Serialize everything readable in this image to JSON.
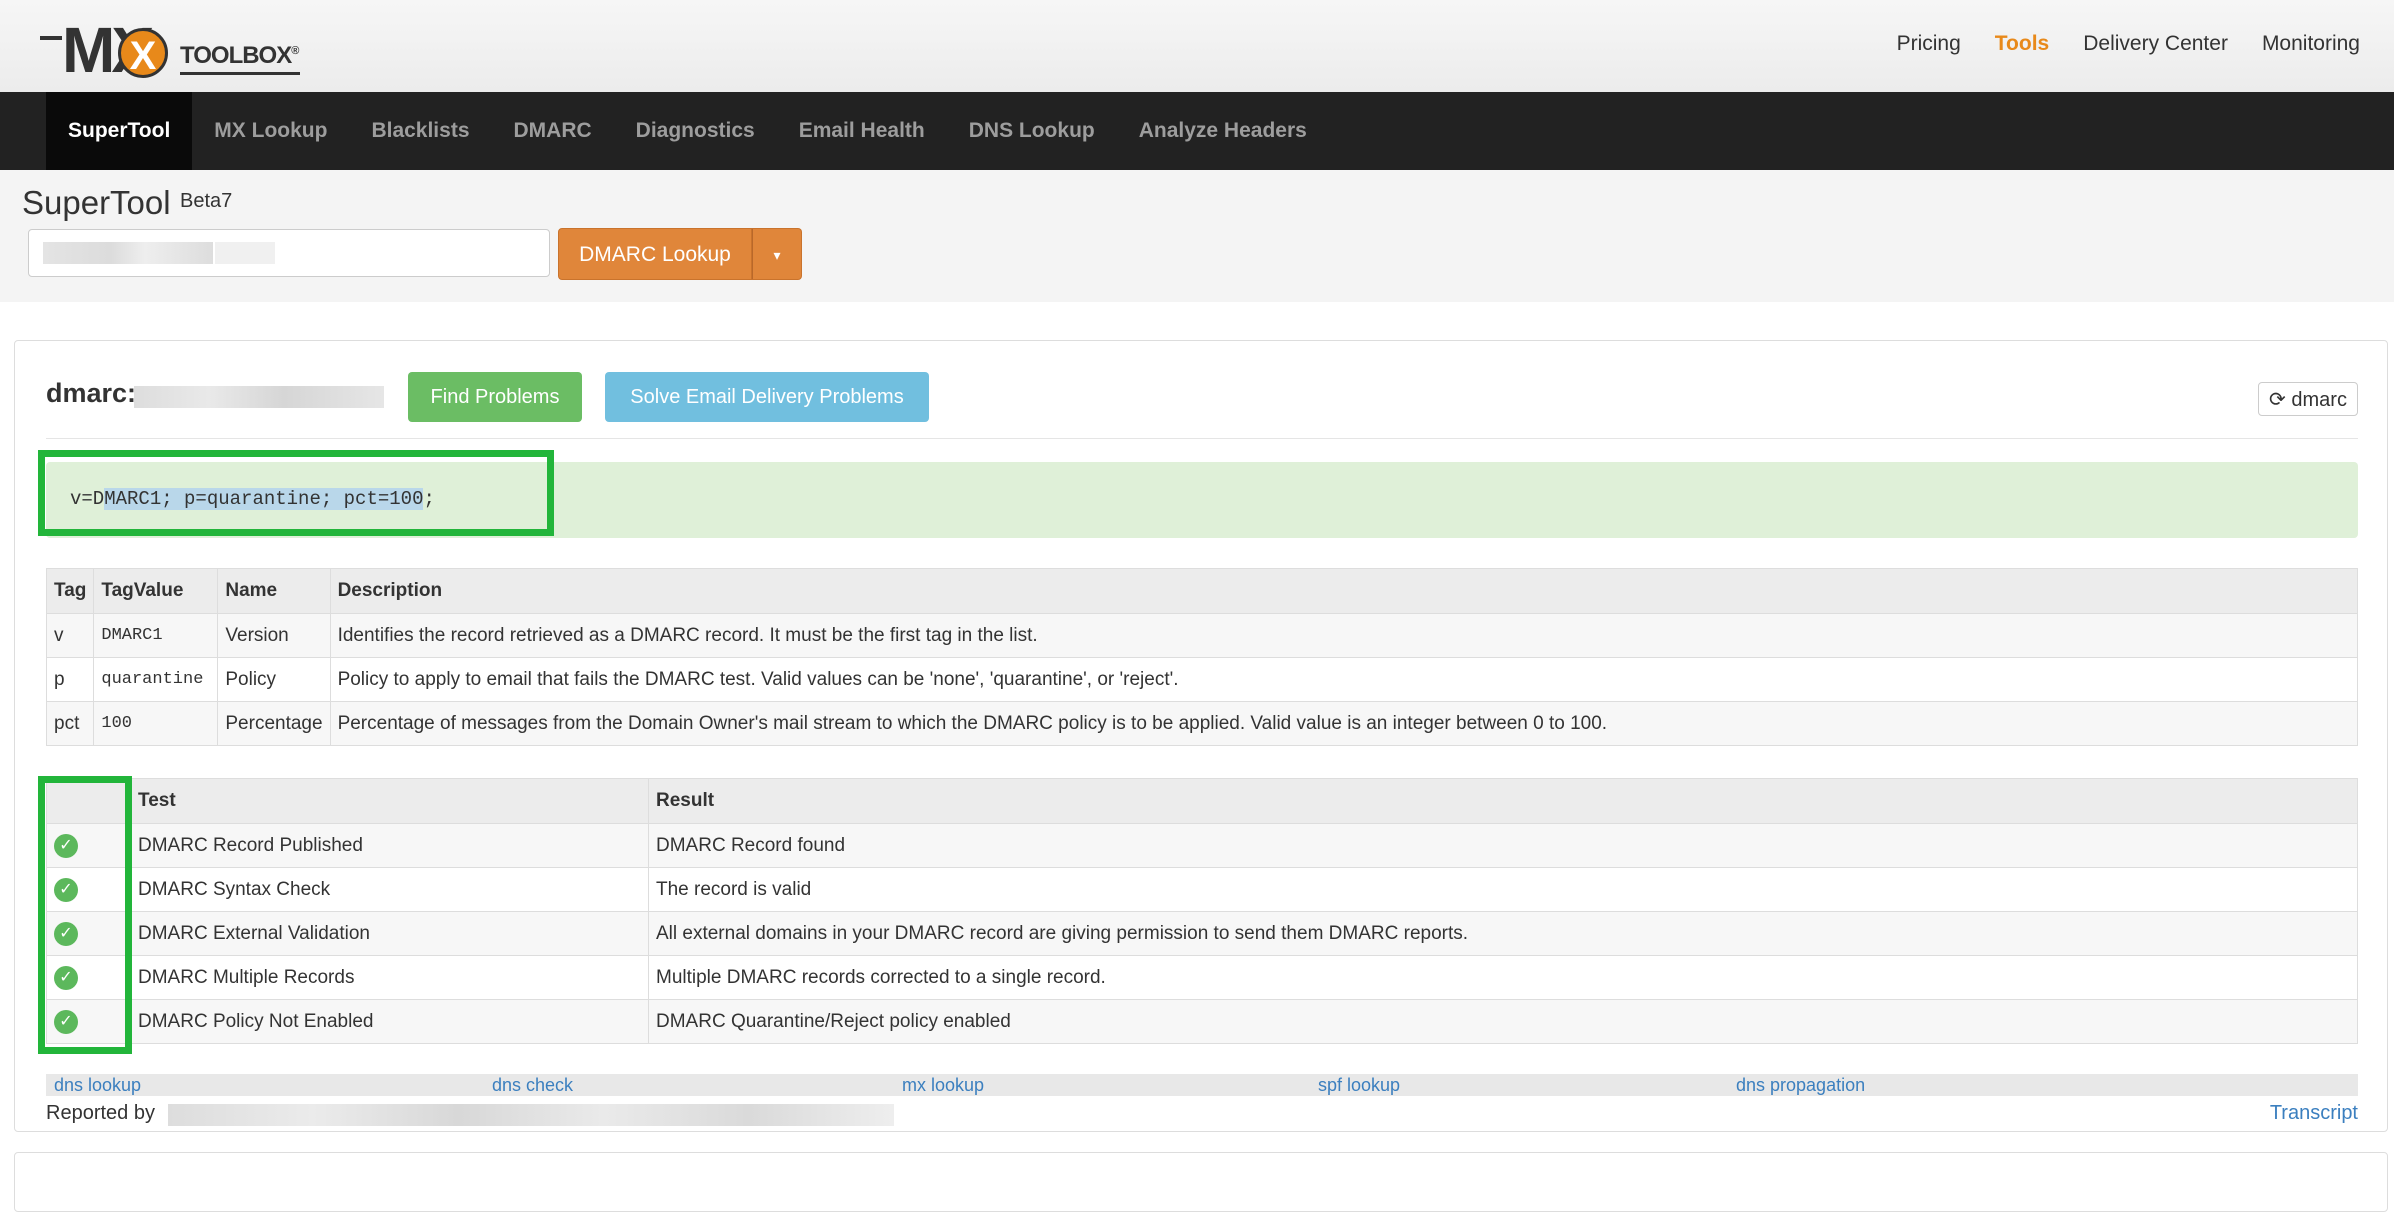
{
  "brand": {
    "logo_mark": "MX",
    "logo_word": "TOOLBOX",
    "logo_reg": "®"
  },
  "topnav": [
    "Pricing",
    "Tools",
    "Delivery Center",
    "Monitoring"
  ],
  "mainnav": [
    "SuperTool",
    "MX Lookup",
    "Blacklists",
    "DMARC",
    "Diagnostics",
    "Email Health",
    "DNS Lookup",
    "Analyze Headers"
  ],
  "supertool": {
    "title": "SuperTool",
    "beta": "Beta7",
    "lookup_button": "DMARC Lookup",
    "caret": "▾"
  },
  "result": {
    "title": "dmarc:",
    "find_problems": "Find Problems",
    "solve_problems": "Solve Email Delivery Problems",
    "refresh_label": "dmarc",
    "record_prefix": "v=D",
    "record_selected": "MARC1; p=quarantine; pct=100",
    "record_suffix": ";"
  },
  "tag_table": {
    "headers": [
      "Tag",
      "TagValue",
      "Name",
      "Description"
    ],
    "rows": [
      [
        "v",
        "DMARC1",
        "Version",
        "Identifies the record retrieved as a DMARC record. It must be the first tag in the list."
      ],
      [
        "p",
        "quarantine",
        "Policy",
        "Policy to apply to email that fails the DMARC test. Valid values can be 'none', 'quarantine', or 'reject'."
      ],
      [
        "pct",
        "100",
        "Percentage",
        "Percentage of messages from the Domain Owner's mail stream to which the DMARC policy is to be applied. Valid value is an integer between 0 to 100."
      ]
    ]
  },
  "test_table": {
    "headers": [
      "",
      "Test",
      "Result"
    ],
    "rows": [
      [
        "DMARC Record Published",
        "DMARC Record found"
      ],
      [
        "DMARC Syntax Check",
        "The record is valid"
      ],
      [
        "DMARC External Validation",
        "All external domains in your DMARC record are giving permission to send them DMARC reports."
      ],
      [
        "DMARC Multiple Records",
        "Multiple DMARC records corrected to a single record."
      ],
      [
        "DMARC Policy Not Enabled",
        "DMARC Quarantine/Reject policy enabled"
      ]
    ]
  },
  "footer_links": [
    "dns lookup",
    "dns check",
    "mx lookup",
    "spf lookup",
    "dns propagation"
  ],
  "reported_by": "Reported by",
  "transcript": "Transcript",
  "colors": {
    "accent": "#e8891a",
    "success": "#5cb85c",
    "highlight": "#22b53a"
  }
}
